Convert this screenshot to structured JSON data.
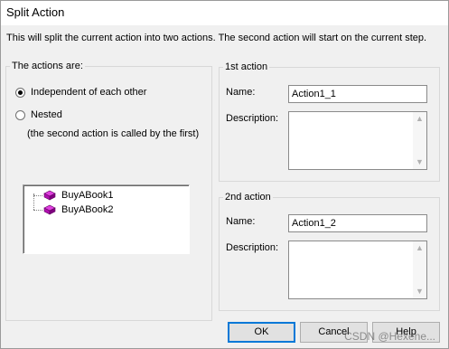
{
  "window": {
    "title": "Split Action"
  },
  "description": "This will split the current action into two actions. The second action will start on the current step.",
  "actions_group": {
    "legend": "The actions are:",
    "options": [
      {
        "label": "Independent of each other",
        "selected": true
      },
      {
        "label": "Nested",
        "selected": false
      }
    ],
    "nested_note": "(the second action is called by the first)",
    "tree": [
      {
        "label": "BuyABook1",
        "icon": "action-cube-icon"
      },
      {
        "label": "BuyABook2",
        "icon": "action-cube-icon"
      }
    ]
  },
  "first_action": {
    "legend": "1st action",
    "name_label": "Name:",
    "name_value": "Action1_1",
    "description_label": "Description:",
    "description_value": ""
  },
  "second_action": {
    "legend": "2nd action",
    "name_label": "Name:",
    "name_value": "Action1_2",
    "description_label": "Description:",
    "description_value": ""
  },
  "buttons": {
    "ok": "OK",
    "cancel": "Cancel",
    "help": "Help"
  },
  "watermark": "CSDN @Hexene...",
  "colors": {
    "accent": "#0078d7",
    "icon": "#c020c0",
    "dialog_bg": "#f0f0f0"
  }
}
